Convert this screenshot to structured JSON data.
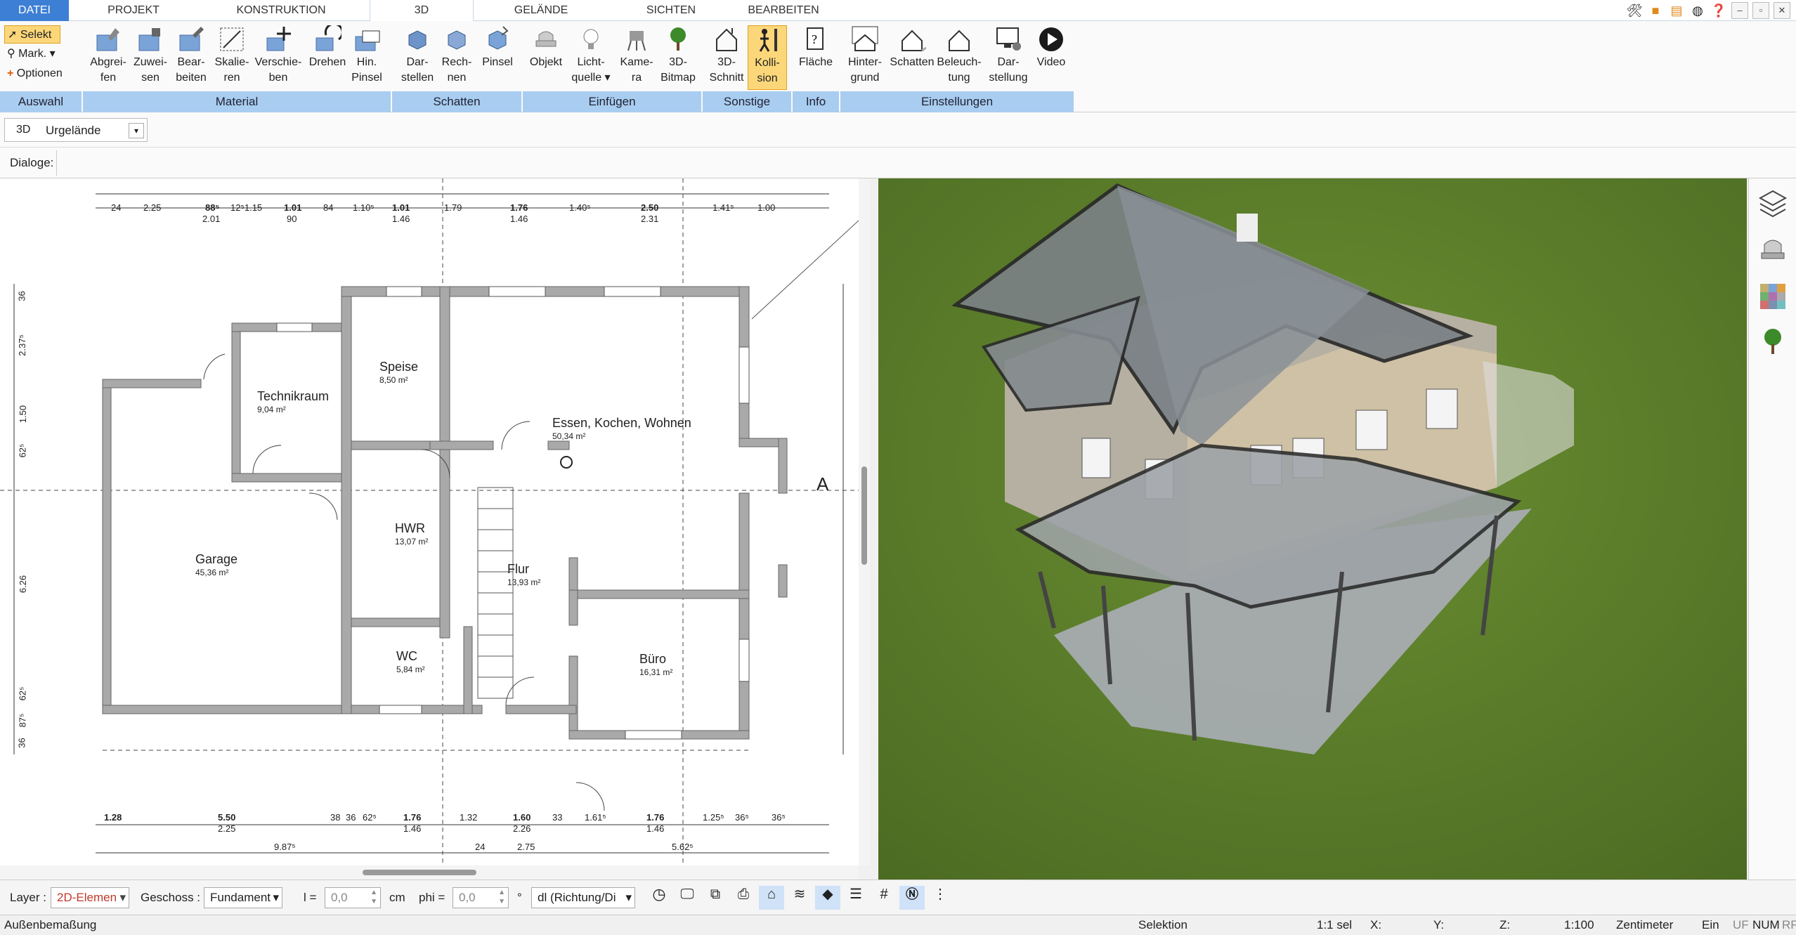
{
  "tabs": [
    "DATEI",
    "PROJEKT",
    "KONSTRUKTION",
    "3D",
    "GELÄNDE",
    "SICHTEN",
    "BEARBEITEN"
  ],
  "ribbon": {
    "auswahl": {
      "label": "Auswahl",
      "selekt": "Selekt",
      "mark": "Mark.",
      "optionen": "Optionen"
    },
    "material": {
      "label": "Material",
      "buttons": [
        [
          "Abgrei-",
          "fen"
        ],
        [
          "Zuwei-",
          "sen"
        ],
        [
          "Bear-",
          "beiten"
        ],
        [
          "Skalie-",
          "ren"
        ],
        [
          "Verschie-",
          "ben"
        ],
        [
          "Drehen",
          ""
        ],
        [
          "Hin.",
          "Pinsel"
        ]
      ]
    },
    "schatten": {
      "label": "Schatten",
      "buttons": [
        [
          "Dar-",
          "stellen"
        ],
        [
          "Rech-",
          "nen"
        ],
        [
          "Pinsel",
          ""
        ]
      ]
    },
    "einfuegen": {
      "label": "Einfügen",
      "buttons": [
        [
          "Objekt",
          ""
        ],
        [
          "Licht-",
          "quelle"
        ],
        [
          "Kame-",
          "ra"
        ],
        [
          "3D-",
          "Bitmap"
        ]
      ]
    },
    "sonstige": {
      "label": "Sonstige",
      "buttons": [
        [
          "3D-",
          "Schnitt"
        ],
        [
          "Kolli-",
          "sion"
        ]
      ]
    },
    "info": {
      "label": "Info",
      "buttons": [
        [
          "Fläche",
          ""
        ]
      ]
    },
    "einstellungen": {
      "label": "Einstellungen",
      "buttons": [
        [
          "Hinter-",
          "grund"
        ],
        [
          "Schatten",
          ""
        ],
        [
          "Beleuch-",
          "tung"
        ],
        [
          "Dar-",
          "stellung"
        ],
        [
          "Video",
          ""
        ]
      ]
    }
  },
  "viewbar": {
    "mode": "3D",
    "terrain": "Urgelände"
  },
  "dialoge": "Dialoge:",
  "plan": {
    "rooms": [
      {
        "name": "Technikraum",
        "area": "9,04 m²"
      },
      {
        "name": "Speise",
        "area": "8,50 m²"
      },
      {
        "name": "Essen, Kochen, Wohnen",
        "area": "50,34 m²"
      },
      {
        "name": "Garage",
        "area": "45,36 m²"
      },
      {
        "name": "HWR",
        "area": "13,07 m²"
      },
      {
        "name": "Flur",
        "area": "13,93 m²"
      },
      {
        "name": "WC",
        "area": "5,84 m²"
      },
      {
        "name": "Büro",
        "area": "16,31 m²"
      }
    ],
    "top_dims": [
      "24",
      "2.25",
      "88⁵",
      "2.01",
      "12⁵1.15",
      "1.01",
      "90",
      "84",
      "1.10⁵",
      "1.01",
      "1.46",
      "1.79",
      "1.76",
      "1.46",
      "1.40⁵",
      "2.50",
      "2.31",
      "1.41⁵",
      "1.00"
    ],
    "bottom_dims": [
      "1.28",
      "5.50",
      "2.25",
      "38",
      "36",
      "62⁵",
      "1.76",
      "1.46",
      "1.32",
      "1.60",
      "2.26",
      "33",
      "1.61⁵",
      "1.76",
      "1.46",
      "1.25⁵",
      "36⁵",
      "36⁵"
    ],
    "bottom_dims2": [
      "9.87⁵",
      "24",
      "2.75",
      "5.62⁵"
    ],
    "left_dims": [
      "36",
      "2.37⁵",
      "1.50",
      "62⁵",
      "6.26",
      "62⁵",
      "87⁵",
      "36"
    ],
    "section": "A"
  },
  "bottombar": {
    "layer_label": "Layer :",
    "layer_value": "2D-Elemen",
    "geschoss_label": "Geschoss :",
    "geschoss_value": "Fundament",
    "l_label": "l =",
    "l_value": "0,0",
    "l_unit": "cm",
    "phi_label": "phi =",
    "phi_value": "0,0",
    "phi_unit": "°",
    "dl_value": "dl (Richtung/Di"
  },
  "status": {
    "hint": "Außenbemaßung",
    "mode": "Selektion",
    "sel": "1:1 sel",
    "x": "X:",
    "y": "Y:",
    "z": "Z:",
    "scale": "1:100",
    "unit": "Zentimeter",
    "ein": "Ein",
    "flags": [
      "UF",
      "NUM",
      "RF"
    ]
  },
  "colors": {
    "accent": "#3d7fd4",
    "group": "#a8cdf0",
    "lawn": "#5a7d2a",
    "selected": "#fbd77a"
  }
}
